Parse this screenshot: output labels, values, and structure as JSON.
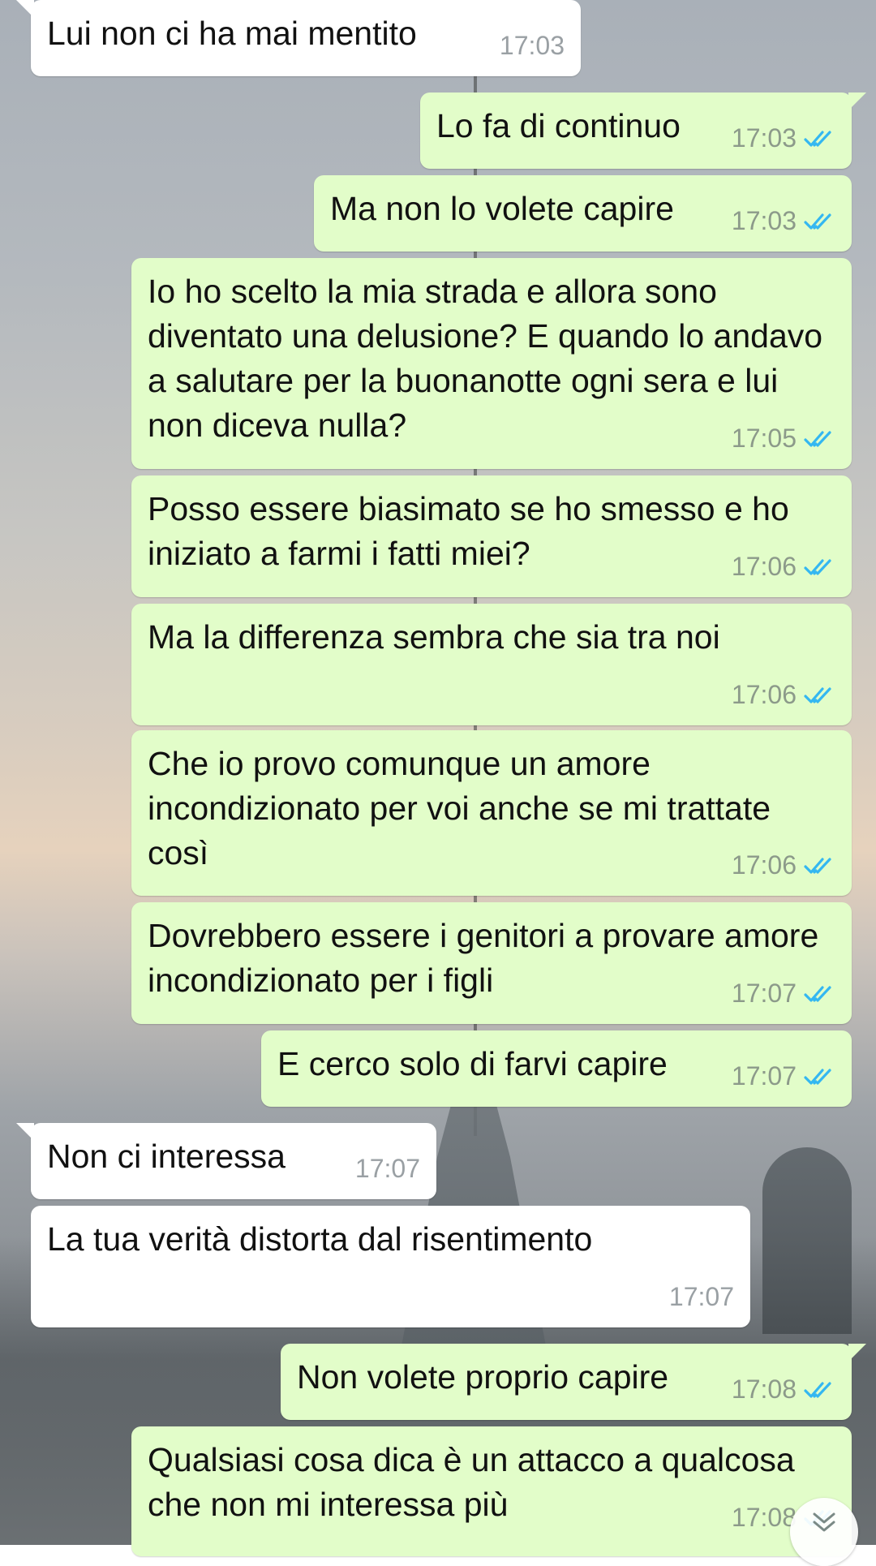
{
  "colors": {
    "incoming_bubble": "#ffffff",
    "outgoing_bubble": "#e2fdc9",
    "read_ticks": "#34b7f1"
  },
  "messages": [
    {
      "direction": "in",
      "text": "Lui non ci ha mai mentito",
      "time": "17:03"
    },
    {
      "direction": "out",
      "text": "Lo fa di continuo",
      "time": "17:03",
      "status": "read"
    },
    {
      "direction": "out",
      "text": "Ma non lo volete capire",
      "time": "17:03",
      "status": "read"
    },
    {
      "direction": "out",
      "text": "Io ho scelto la mia strada e allora sono diventato una delusione? E quando lo andavo a salutare per la buonanotte ogni sera e lui non diceva nulla?",
      "time": "17:05",
      "status": "read"
    },
    {
      "direction": "out",
      "text": "Posso essere biasimato se ho smesso e ho iniziato a farmi i fatti miei?",
      "time": "17:06",
      "status": "read"
    },
    {
      "direction": "out",
      "text": "Ma la differenza sembra che sia tra noi",
      "time": "17:06",
      "status": "read"
    },
    {
      "direction": "out",
      "text": "Che io provo comunque un amore incondizionato per voi anche se mi trattate così",
      "time": "17:06",
      "status": "read"
    },
    {
      "direction": "out",
      "text": "Dovrebbero essere i genitori a provare amore incondizionato per i figli",
      "time": "17:07",
      "status": "read"
    },
    {
      "direction": "out",
      "text": "E cerco solo di farvi capire",
      "time": "17:07",
      "status": "read"
    },
    {
      "direction": "in",
      "text": "Non ci interessa",
      "time": "17:07"
    },
    {
      "direction": "in",
      "text": "La tua verità distorta dal risentimento",
      "time": "17:07"
    },
    {
      "direction": "out",
      "text": "Non volete proprio capire",
      "time": "17:08",
      "status": "read"
    },
    {
      "direction": "out",
      "text": "Qualsiasi cosa dica è un attacco a qualcosa che non mi interessa più",
      "time": "17:08",
      "status": "read"
    }
  ],
  "scroll_button": {
    "icon": "double-chevron-down-icon"
  }
}
